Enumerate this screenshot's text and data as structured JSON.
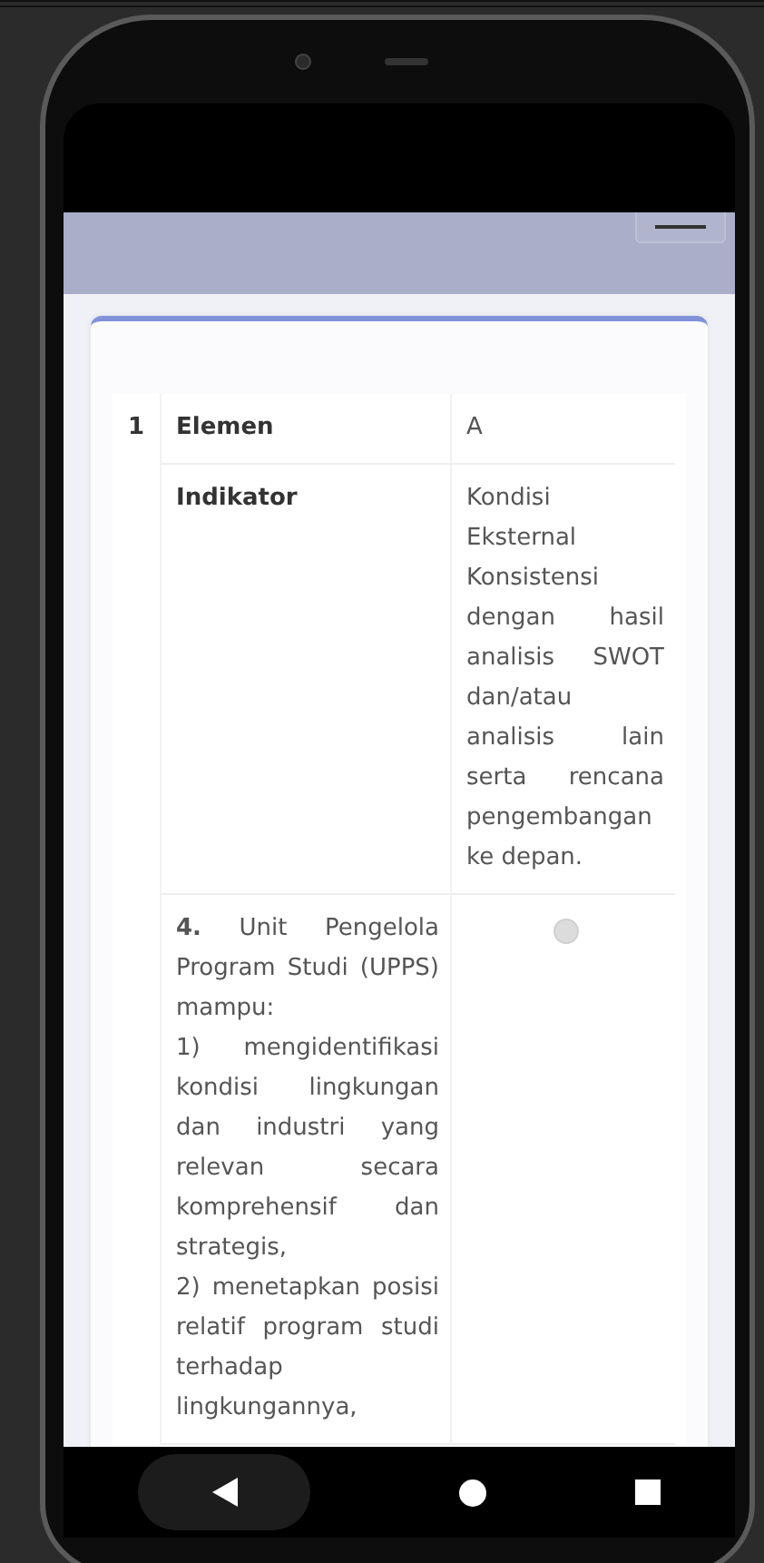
{
  "table": {
    "rows": [
      {
        "kind": "field",
        "number": "1",
        "label": "Elemen",
        "value": "A"
      },
      {
        "kind": "field",
        "label": "Indikator",
        "value": "Kondisi Eksternal Konsistensi dengan hasil analisis SWOT dan/atau analisis lain serta rencana pengembangan ke depan."
      },
      {
        "kind": "option",
        "text": "**4.** Unit Pengelola Program Studi (UPPS) mampu:\n1) mengidentifikasi kondisi lingkungan dan industri yang relevan secara komprehensif dan strategis,\n2) menetapkan posisi relatif program studi terhadap lingkungannya,",
        "selected": false
      }
    ]
  }
}
